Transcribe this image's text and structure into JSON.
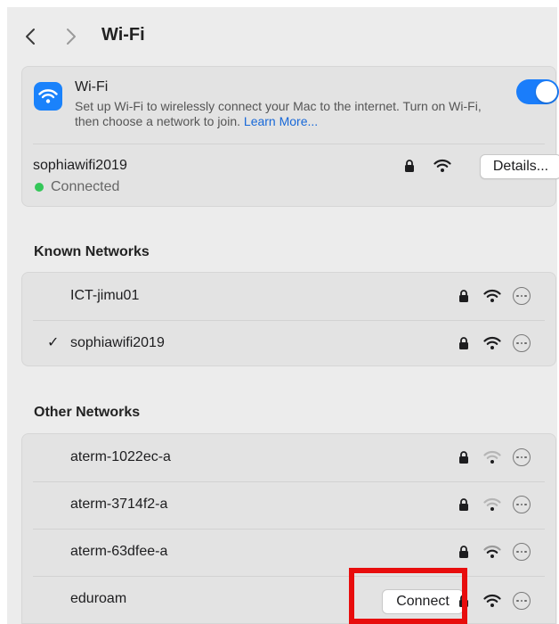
{
  "toolbar": {
    "title": "Wi-Fi",
    "back_icon": "chevron-left-icon",
    "forward_icon": "chevron-right-icon"
  },
  "wifi": {
    "title": "Wi-Fi",
    "description": "Set up Wi-Fi to wirelessly connect your Mac to the internet. Turn on Wi-Fi, then choose a network to join.",
    "learn_more": "Learn More...",
    "enabled": true,
    "accent_color": "#1a7dfa"
  },
  "current": {
    "name": "sophiawifi2019",
    "status": "Connected",
    "status_color": "#34c759",
    "details_label": "Details..."
  },
  "known_networks": {
    "heading": "Known Networks",
    "items": [
      {
        "name": "ICT-jimu01",
        "checked": false,
        "secured": true,
        "signal": "strong"
      },
      {
        "name": "sophiawifi2019",
        "checked": true,
        "check_mark": "✓",
        "secured": true,
        "signal": "strong"
      }
    ]
  },
  "other_networks": {
    "heading": "Other Networks",
    "items": [
      {
        "name": "aterm-1022ec-a",
        "secured": true,
        "signal": "weak"
      },
      {
        "name": "aterm-3714f2-a",
        "secured": true,
        "signal": "weak"
      },
      {
        "name": "aterm-63dfee-a",
        "secured": true,
        "signal": "strong"
      },
      {
        "name": "eduroam",
        "secured": true,
        "signal": "strong",
        "connect_label": "Connect"
      }
    ]
  },
  "annotation": {
    "highlight_color": "#e80d0d"
  }
}
